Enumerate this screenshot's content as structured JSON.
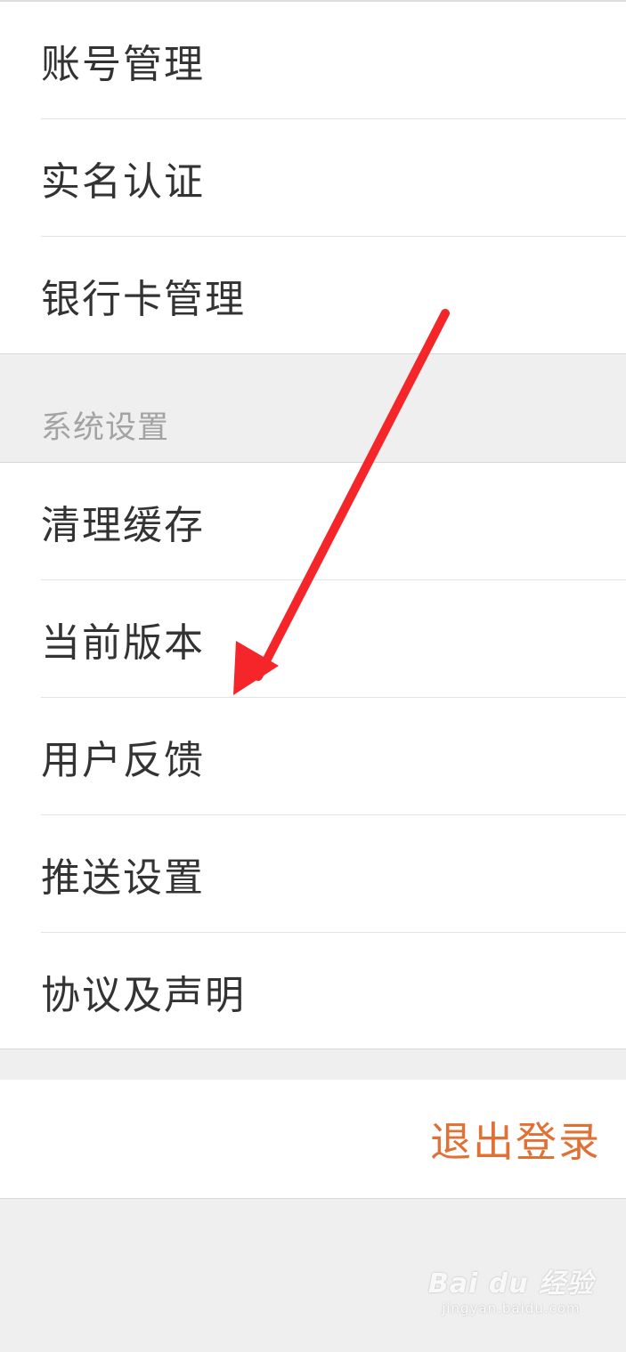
{
  "account_section": {
    "items": [
      {
        "label": "账号管理"
      },
      {
        "label": "实名认证"
      },
      {
        "label": "银行卡管理"
      }
    ]
  },
  "system_section": {
    "header": "系统设置",
    "items": [
      {
        "label": "清理缓存"
      },
      {
        "label": "当前版本"
      },
      {
        "label": "用户反馈"
      },
      {
        "label": "推送设置"
      },
      {
        "label": "协议及声明"
      }
    ]
  },
  "logout": {
    "label": "退出登录"
  },
  "watermark": {
    "brand": "Bai du 经验",
    "url": "jingyan.baidu.com"
  },
  "colors": {
    "logout_text": "#e07033",
    "annotation_arrow": "#f5262a",
    "section_header_text": "#a3a3a3"
  }
}
